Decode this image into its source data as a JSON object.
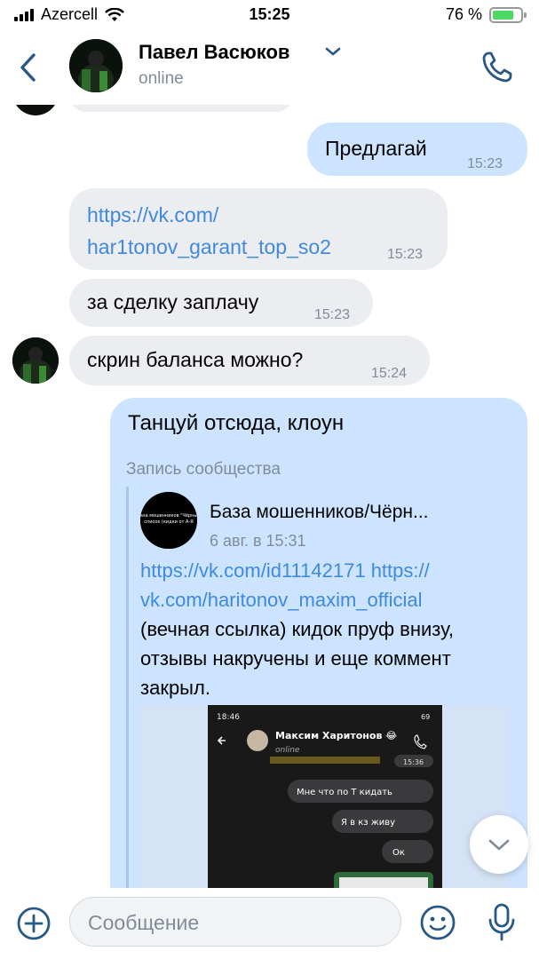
{
  "status_bar": {
    "carrier": "Azercell",
    "time": "15:25",
    "battery_text": "76 %",
    "battery_level": 0.76,
    "battery_color": "#4cd964"
  },
  "header": {
    "contact_name": "Павел Васюков",
    "status": "online",
    "back_icon": "chevron-left-icon",
    "call_icon": "phone-icon",
    "dropdown_icon": "chevron-down-icon"
  },
  "messages": [
    {
      "direction": "out",
      "text": "Предлагай",
      "time": "15:23"
    },
    {
      "direction": "in",
      "link_line1": "https://vk.com/",
      "link_line2": "har1tonov_garant_top_so2",
      "time": "15:23"
    },
    {
      "direction": "in",
      "text": "за сделку заплачу",
      "time": "15:23"
    },
    {
      "direction": "in",
      "text": "скрин баланса можно?",
      "time": "15:24"
    }
  ],
  "forwarded_message": {
    "text": "Танцуй отсюда, клоун",
    "label": "Запись сообщества",
    "post": {
      "community_name": "База мошенников/Чёрн...",
      "date": "6 авг. в 15:31",
      "avatar_text": "База мошенников \"Чёрный список (кидки от А-Я",
      "link1": "https://vk.com/id11142171",
      "link2_part1": "https://",
      "link2_part2": "vk.com/haritonov_maxim_official",
      "body": "(вечная ссылка) кидок пруф внизу, отзывы накручены и еще коммент закрыл.",
      "screenshot": {
        "time": "18:46",
        "battery": "69",
        "name": "Максим Харитонов 😂",
        "status": "online",
        "time_chip": "15:36",
        "messages": [
          "Мне что по Т кидать",
          "Я в кз живу",
          "Ок"
        ]
      }
    }
  },
  "composer": {
    "placeholder": "Сообщение",
    "add_icon": "plus-circle-icon",
    "emoji_icon": "smile-icon",
    "mic_icon": "microphone-icon"
  },
  "colors": {
    "accent": "#2a5885",
    "link": "#3f8ae0",
    "incoming_bubble": "#ebedf0",
    "outgoing_bubble": "#cce4ff",
    "muted_text": "#818c99"
  }
}
